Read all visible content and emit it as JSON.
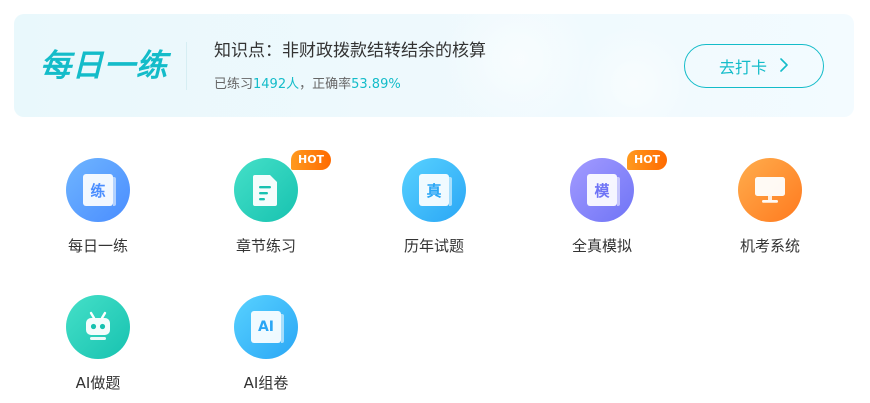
{
  "banner": {
    "title": "每日一练",
    "knowledge_point": "知识点：非财政拨款结转结余的核算",
    "stats_prefix": "已练习",
    "stats_count": "1492人",
    "stats_mid": "，正确率",
    "stats_rate": "53.89%",
    "checkin_label": "去打卡",
    "accent_color": "#14bcc9"
  },
  "items": [
    {
      "label": "每日一练",
      "icon": "book-lian-icon",
      "glyph": "练",
      "hot": ""
    },
    {
      "label": "章节练习",
      "icon": "document-icon",
      "glyph": "",
      "hot": "HOT"
    },
    {
      "label": "历年试题",
      "icon": "book-zhen-icon",
      "glyph": "真",
      "hot": ""
    },
    {
      "label": "全真模拟",
      "icon": "book-mo-icon",
      "glyph": "模",
      "hot": "HOT"
    },
    {
      "label": "机考系统",
      "icon": "monitor-icon",
      "glyph": "",
      "hot": ""
    },
    {
      "label": "AI做题",
      "icon": "robot-icon",
      "glyph": "",
      "hot": ""
    },
    {
      "label": "AI组卷",
      "icon": "book-ai-icon",
      "glyph": "AI",
      "hot": ""
    }
  ]
}
